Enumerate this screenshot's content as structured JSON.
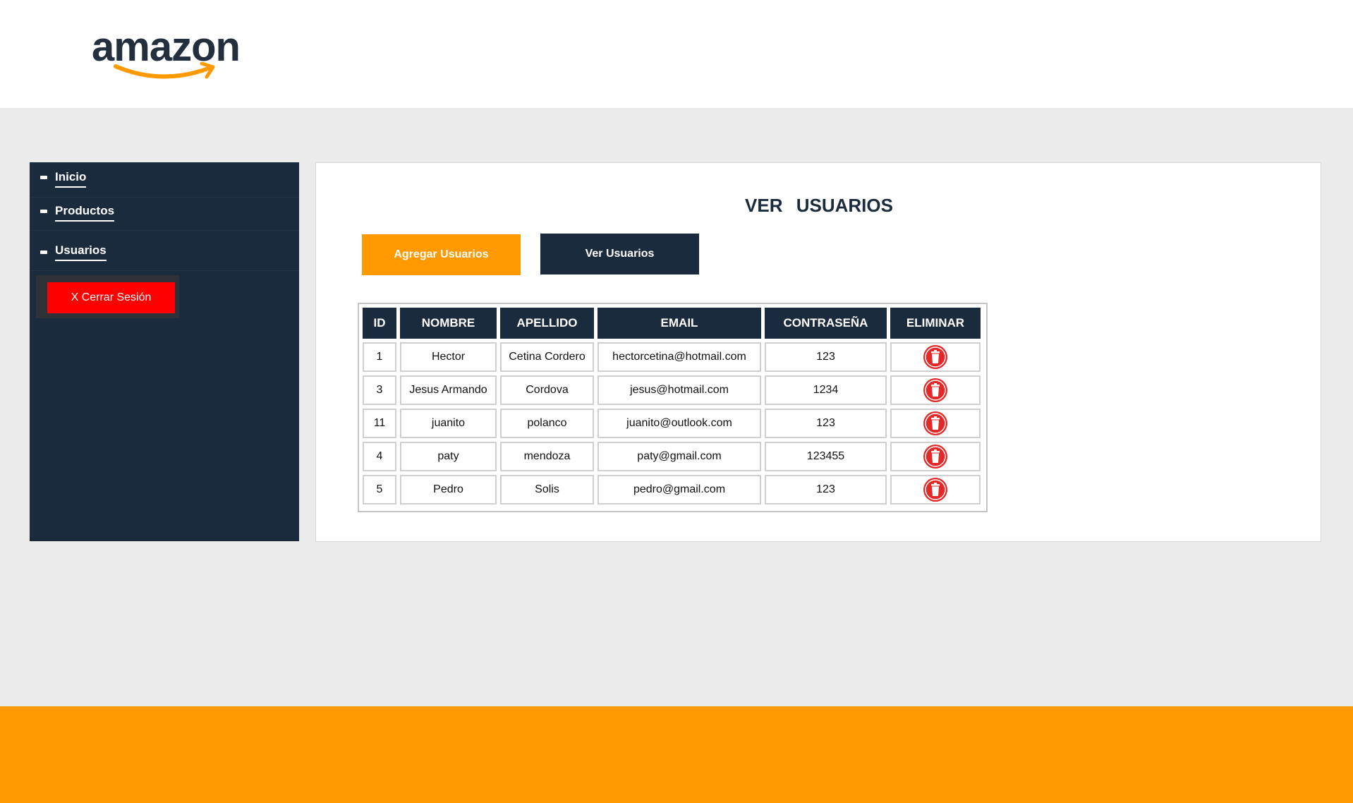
{
  "brand": {
    "logo_text": "amazon"
  },
  "sidebar": {
    "items": [
      {
        "label": "Inicio"
      },
      {
        "label": "Productos"
      },
      {
        "label": "Usuarios"
      }
    ],
    "logout_label": "X Cerrar Sesión"
  },
  "main": {
    "title": "VER USUARIOS",
    "add_button": "Agregar Usuarios",
    "view_button": "Ver Usuarios",
    "table": {
      "headers": [
        "ID",
        "NOMBRE",
        "APELLIDO",
        "EMAIL",
        "CONTRASEÑA",
        "ELIMINAR"
      ],
      "rows": [
        {
          "id": "1",
          "nombre": "Hector",
          "apellido": "Cetina Cordero",
          "email": "hectorcetina@hotmail.com",
          "password": "123"
        },
        {
          "id": "3",
          "nombre": "Jesus Armando",
          "apellido": "Cordova",
          "email": "jesus@hotmail.com",
          "password": "1234"
        },
        {
          "id": "11",
          "nombre": "juanito",
          "apellido": "polanco",
          "email": "juanito@outlook.com",
          "password": "123"
        },
        {
          "id": "4",
          "nombre": "paty",
          "apellido": "mendoza",
          "email": "paty@gmail.com",
          "password": "123455"
        },
        {
          "id": "5",
          "nombre": "Pedro",
          "apellido": "Solis",
          "email": "pedro@gmail.com",
          "password": "123"
        }
      ]
    }
  },
  "colors": {
    "navy": "#1b2b3e",
    "orange": "#ff9900",
    "red": "#ff0000",
    "delete_red": "#e52727"
  },
  "icons": {
    "delete": "trash-icon",
    "nav_bullet": "dash-icon"
  }
}
